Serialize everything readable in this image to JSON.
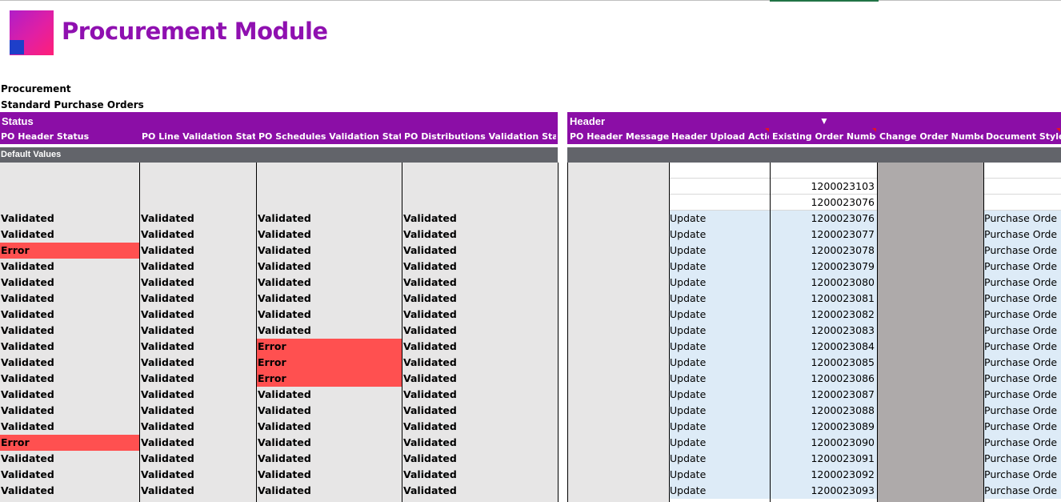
{
  "app": {
    "title": "Procurement Module",
    "line1": "Procurement",
    "line2": "Standard Purchase Orders"
  },
  "sections": {
    "status_title": "Status",
    "header_title": "Header",
    "filter_glyph": "▼",
    "default_values": "Default Values"
  },
  "columns": {
    "po_header_status": "PO Header Status",
    "po_line_validation_status": "PO Line Validation Status",
    "po_schedules_validation_status": "PO Schedules Validation Status",
    "po_distributions_validation_status": "PO Distributions Validation Status",
    "po_header_messages": "PO Header Messages",
    "header_upload_action": "Header Upload Action",
    "existing_order_number": "Existing Order Number",
    "change_order_number": "Change Order Number",
    "document_style": "Document Style"
  },
  "pre_rows": [
    "",
    "1200023103",
    "1200023076"
  ],
  "rows": [
    {
      "h": "Validated",
      "l": "Validated",
      "s": "Validated",
      "d": "Validated",
      "a": "Update",
      "o": "1200023076",
      "ds": "Purchase Orde"
    },
    {
      "h": "Validated",
      "l": "Validated",
      "s": "Validated",
      "d": "Validated",
      "a": "Update",
      "o": "1200023077",
      "ds": "Purchase Orde"
    },
    {
      "h": "Error",
      "l": "Validated",
      "s": "Validated",
      "d": "Validated",
      "a": "Update",
      "o": "1200023078",
      "ds": "Purchase Orde"
    },
    {
      "h": "Validated",
      "l": "Validated",
      "s": "Validated",
      "d": "Validated",
      "a": "Update",
      "o": "1200023079",
      "ds": "Purchase Orde"
    },
    {
      "h": "Validated",
      "l": "Validated",
      "s": "Validated",
      "d": "Validated",
      "a": "Update",
      "o": "1200023080",
      "ds": "Purchase Orde"
    },
    {
      "h": "Validated",
      "l": "Validated",
      "s": "Validated",
      "d": "Validated",
      "a": "Update",
      "o": "1200023081",
      "ds": "Purchase Orde"
    },
    {
      "h": "Validated",
      "l": "Validated",
      "s": "Validated",
      "d": "Validated",
      "a": "Update",
      "o": "1200023082",
      "ds": "Purchase Orde"
    },
    {
      "h": "Validated",
      "l": "Validated",
      "s": "Validated",
      "d": "Validated",
      "a": "Update",
      "o": "1200023083",
      "ds": "Purchase Orde"
    },
    {
      "h": "Validated",
      "l": "Validated",
      "s": "Error",
      "d": "Validated",
      "a": "Update",
      "o": "1200023084",
      "ds": "Purchase Orde"
    },
    {
      "h": "Validated",
      "l": "Validated",
      "s": "Error",
      "d": "Validated",
      "a": "Update",
      "o": "1200023085",
      "ds": "Purchase Orde"
    },
    {
      "h": "Validated",
      "l": "Validated",
      "s": "Error",
      "d": "Validated",
      "a": "Update",
      "o": "1200023086",
      "ds": "Purchase Orde"
    },
    {
      "h": "Validated",
      "l": "Validated",
      "s": "Validated",
      "d": "Validated",
      "a": "Update",
      "o": "1200023087",
      "ds": "Purchase Orde"
    },
    {
      "h": "Validated",
      "l": "Validated",
      "s": "Validated",
      "d": "Validated",
      "a": "Update",
      "o": "1200023088",
      "ds": "Purchase Orde"
    },
    {
      "h": "Validated",
      "l": "Validated",
      "s": "Validated",
      "d": "Validated",
      "a": "Update",
      "o": "1200023089",
      "ds": "Purchase Orde"
    },
    {
      "h": "Error",
      "l": "Validated",
      "s": "Validated",
      "d": "Validated",
      "a": "Update",
      "o": "1200023090",
      "ds": "Purchase Orde"
    },
    {
      "h": "Validated",
      "l": "Validated",
      "s": "Validated",
      "d": "Validated",
      "a": "Update",
      "o": "1200023091",
      "ds": "Purchase Orde"
    },
    {
      "h": "Validated",
      "l": "Validated",
      "s": "Validated",
      "d": "Validated",
      "a": "Update",
      "o": "1200023092",
      "ds": "Purchase Orde"
    },
    {
      "h": "Validated",
      "l": "Validated",
      "s": "Validated",
      "d": "Validated",
      "a": "Update",
      "o": "1200023093",
      "ds": "Purchase Orde"
    }
  ],
  "colors": {
    "brand_purple": "#8b0ea6",
    "error_red": "#ff5050",
    "status_gray": "#e7e6e6",
    "input_blue": "#ddebf7",
    "locked_gray": "#aeaaaa",
    "section_bar": "#62646a"
  }
}
